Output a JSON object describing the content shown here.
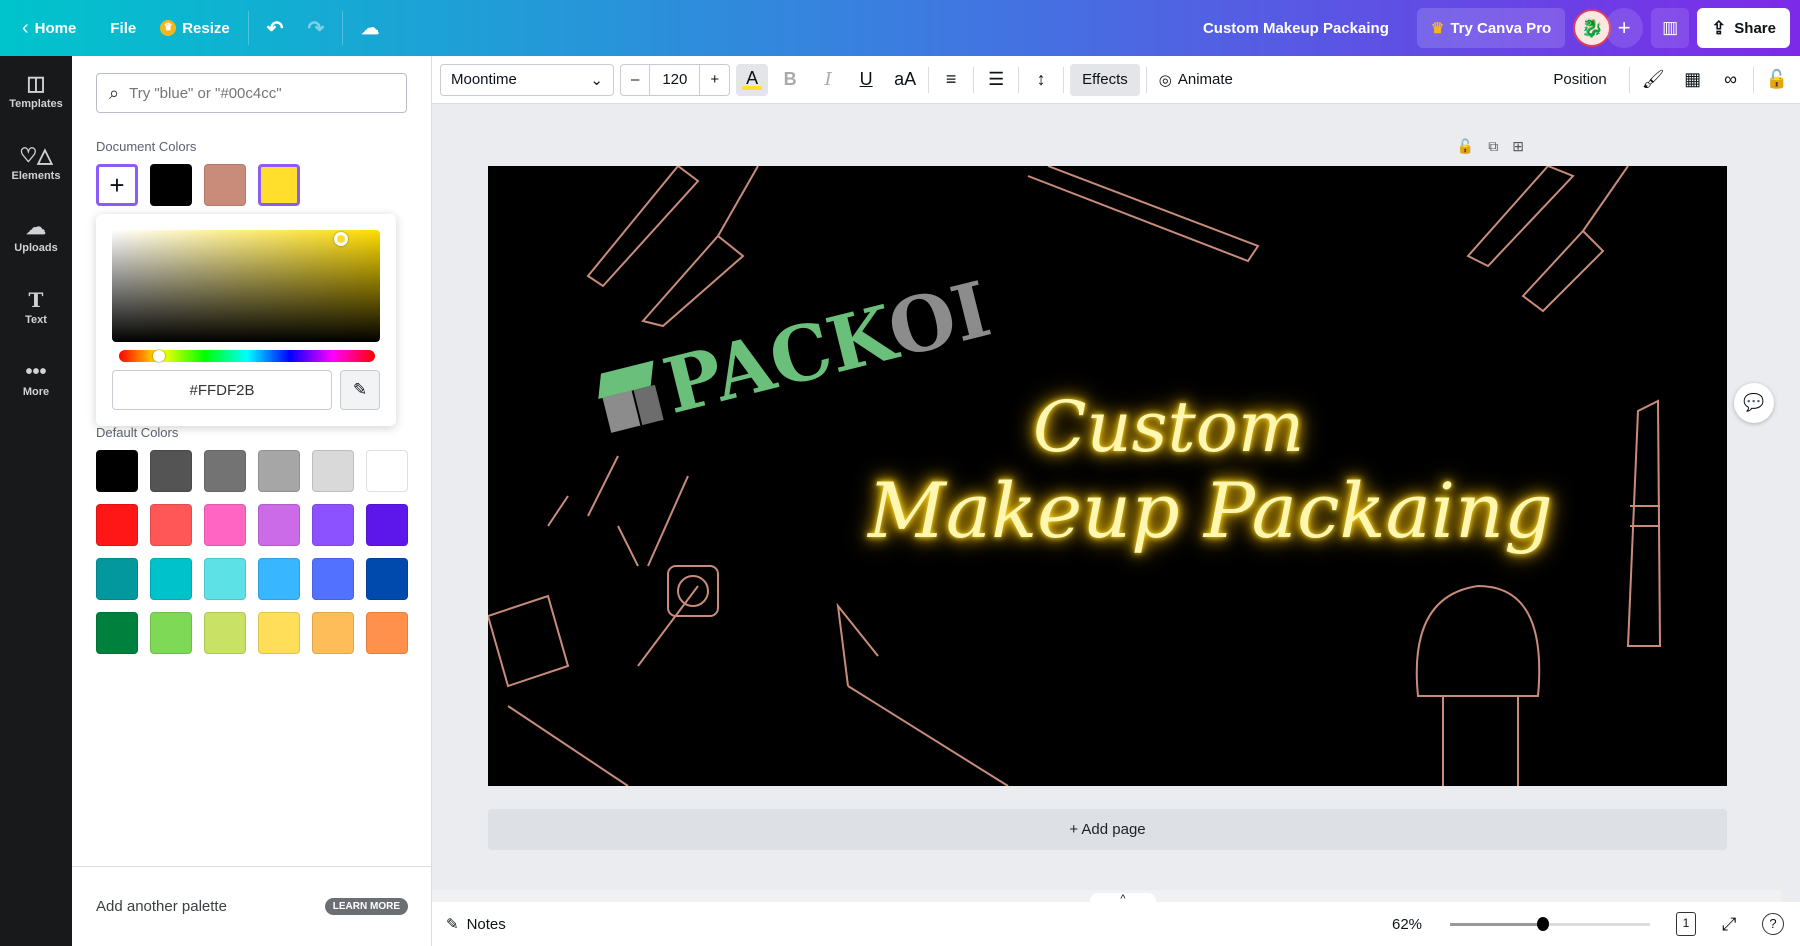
{
  "topbar": {
    "home": "Home",
    "file": "File",
    "resize": "Resize",
    "doc_title": "Custom Makeup Packaing",
    "try_pro": "Try Canva Pro",
    "share": "Share"
  },
  "rail": [
    {
      "label": "Templates",
      "icon": "templates-icon"
    },
    {
      "label": "Elements",
      "icon": "elements-icon"
    },
    {
      "label": "Uploads",
      "icon": "uploads-icon"
    },
    {
      "label": "Text",
      "icon": "text-icon"
    },
    {
      "label": "More",
      "icon": "more-icon"
    }
  ],
  "panel": {
    "search_placeholder": "Try \"blue\" or \"#00c4cc\"",
    "document_colors_label": "Document Colors",
    "document_colors": [
      "#000000",
      "#c98c7a",
      "#ffdf2b"
    ],
    "picker_hex": "#FFDF2B",
    "default_colors_label": "Default Colors",
    "default_colors": [
      "#000000",
      "#545454",
      "#737373",
      "#a6a6a6",
      "#d9d9d9",
      "#ffffff",
      "#ff1616",
      "#ff5757",
      "#ff66c4",
      "#cb6ce6",
      "#8c52ff",
      "#5e17eb",
      "#03989e",
      "#00c2cb",
      "#5ce1e6",
      "#38b6ff",
      "#5271ff",
      "#004aad",
      "#00803d",
      "#7ed957",
      "#c9e265",
      "#ffde59",
      "#ffbd59",
      "#ff914d"
    ],
    "add_palette": "Add another palette",
    "learn_more": "LEARN MORE"
  },
  "toolbar": {
    "font": "Moontime",
    "minus": "–",
    "size": "120",
    "plus": "+",
    "text_color_label": "A",
    "bold": "B",
    "italic": "I",
    "underline": "U",
    "case": "aA",
    "effects": "Effects",
    "animate": "Animate",
    "position": "Position"
  },
  "design": {
    "logo_pack": "PACK",
    "logo_oi": "OI",
    "line1": "Custom",
    "line2": "Makeup Packaing",
    "logo_green": "#6abf7b",
    "neon_color": "#ffdf2b",
    "outline_color": "#c98c7a"
  },
  "add_page": "+ Add page",
  "bottom": {
    "notes": "Notes",
    "zoom": "62%",
    "zoom_value": 62,
    "page": "1"
  }
}
